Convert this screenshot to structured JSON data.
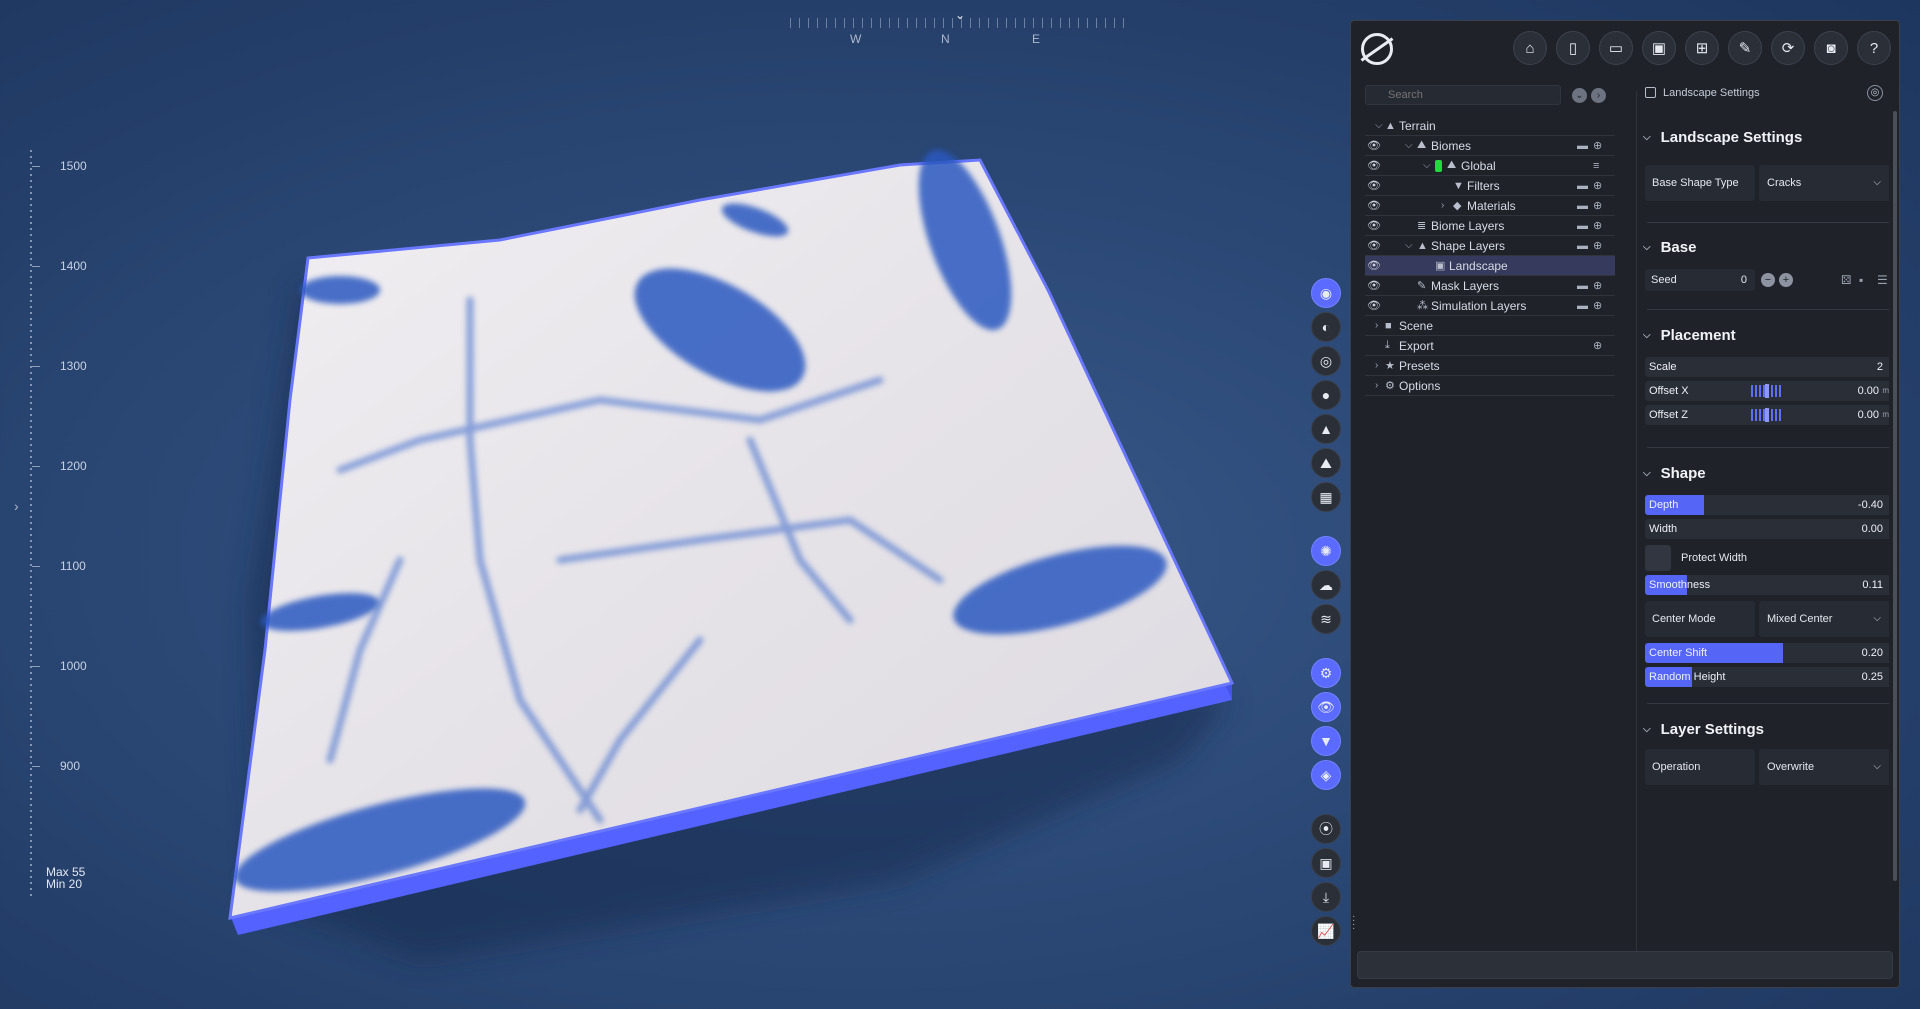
{
  "compass": {
    "needle": "⌄",
    "west": "W",
    "north": "N",
    "east": "E"
  },
  "ruler": {
    "labels": [
      "1500",
      "1400",
      "1300",
      "1200",
      "1100",
      "1000",
      "900"
    ],
    "max": "Max 55",
    "min": "Min 20"
  },
  "colors": {
    "accent": "#5b6bff",
    "terrain_edge": "#5565ff",
    "water": "#2454b8",
    "snow": "#e8e6ea"
  },
  "search": {
    "placeholder": "Search"
  },
  "tree": [
    {
      "label": "Terrain",
      "icon": "mountain-icon",
      "eye": false,
      "chevron": "v",
      "indent": 0
    },
    {
      "label": "Biomes",
      "icon": "hills-icon",
      "eye": true,
      "chevron": "v",
      "indent": 1
    },
    {
      "label": "Global",
      "icon": "hills-icon",
      "eye": true,
      "chevron": "v",
      "indent": 2,
      "green": true
    },
    {
      "label": "Filters",
      "icon": "filter-icon",
      "eye": true,
      "chevron": "",
      "indent": 3
    },
    {
      "label": "Materials",
      "icon": "cube-icon",
      "eye": true,
      "chevron": ">",
      "indent": 3
    },
    {
      "label": "Biome Layers",
      "icon": "layers-icon",
      "eye": true,
      "chevron": "",
      "indent": 1
    },
    {
      "label": "Shape Layers",
      "icon": "mountain-icon",
      "eye": true,
      "chevron": "v",
      "indent": 1
    },
    {
      "label": "Landscape",
      "icon": "image-icon",
      "eye": true,
      "chevron": "",
      "indent": 2,
      "selected": true
    },
    {
      "label": "Mask Layers",
      "icon": "brush-icon",
      "eye": true,
      "chevron": "",
      "indent": 1
    },
    {
      "label": "Simulation Layers",
      "icon": "nodes-icon",
      "eye": true,
      "chevron": "",
      "indent": 1
    },
    {
      "label": "Scene",
      "icon": "camera-icon",
      "eye": false,
      "chevron": ">",
      "indent": 0
    },
    {
      "label": "Export",
      "icon": "download-icon",
      "eye": false,
      "chevron": "",
      "indent": 0
    },
    {
      "label": "Presets",
      "icon": "star-icon",
      "eye": false,
      "chevron": ">",
      "indent": 0
    },
    {
      "label": "Options",
      "icon": "gear-icon",
      "eye": false,
      "chevron": ">",
      "indent": 0
    }
  ],
  "settings": {
    "header": "Landscape Settings",
    "section_main": "Landscape Settings",
    "base_shape_type": {
      "label": "Base Shape Type",
      "value": "Cracks"
    },
    "section_base": "Base",
    "seed": {
      "label": "Seed",
      "value": "0"
    },
    "section_placement": "Placement",
    "scale": {
      "label": "Scale",
      "value": "2"
    },
    "offset_x": {
      "label": "Offset X",
      "value": "0.00",
      "unit": "m"
    },
    "offset_z": {
      "label": "Offset Z",
      "value": "0.00",
      "unit": "m"
    },
    "section_shape": "Shape",
    "depth": {
      "label": "Depth",
      "value": "-0.40",
      "fill": 0.24
    },
    "width": {
      "label": "Width",
      "value": "0.00",
      "fill": 0
    },
    "protect_width": {
      "label": "Protect Width"
    },
    "smoothness": {
      "label": "Smoothness",
      "value": "0.11",
      "fill": 0.17
    },
    "center_mode": {
      "label": "Center Mode",
      "value": "Mixed Center"
    },
    "center_shift": {
      "label": "Center Shift",
      "value": "0.20",
      "fill": 0.56
    },
    "random_height": {
      "label": "Random Height",
      "value": "0.25",
      "fill": 0.19
    },
    "section_layer": "Layer Settings",
    "operation": {
      "label": "Operation",
      "value": "Overwrite"
    }
  }
}
